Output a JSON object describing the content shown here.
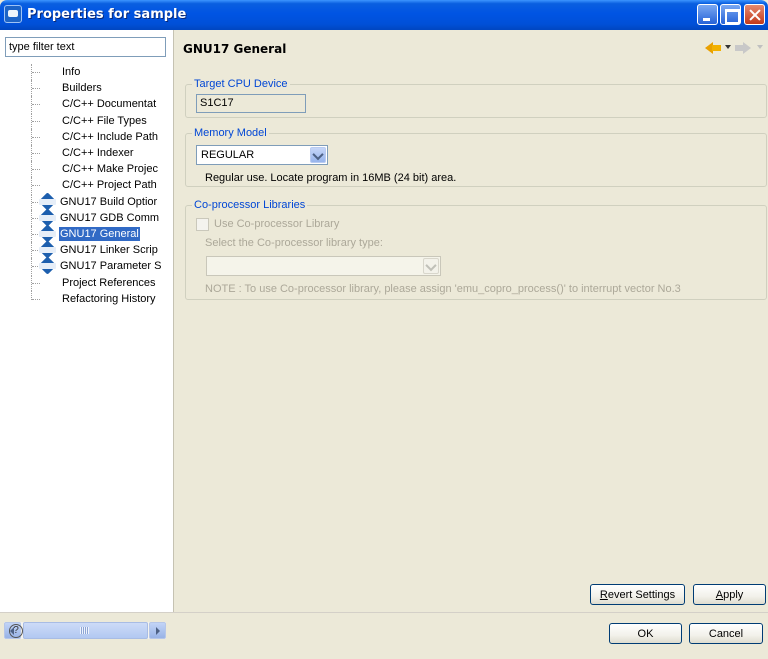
{
  "window": {
    "title": "Properties for sample"
  },
  "filter": {
    "value": "type filter text"
  },
  "tree": {
    "items": [
      {
        "label": "Info",
        "icon": null,
        "selected": false
      },
      {
        "label": "Builders",
        "icon": null,
        "selected": false
      },
      {
        "label": "C/C++ Documentat",
        "icon": null,
        "selected": false
      },
      {
        "label": "C/C++ File Types",
        "icon": null,
        "selected": false
      },
      {
        "label": "C/C++ Include Path",
        "icon": null,
        "selected": false
      },
      {
        "label": "C/C++ Indexer",
        "icon": null,
        "selected": false
      },
      {
        "label": "C/C++ Make Projec",
        "icon": null,
        "selected": false
      },
      {
        "label": "C/C++ Project Path",
        "icon": null,
        "selected": false
      },
      {
        "label": "GNU17 Build Optior",
        "icon": "gnu-icon",
        "selected": false
      },
      {
        "label": "GNU17 GDB Comm",
        "icon": "gnu-icon",
        "selected": false
      },
      {
        "label": "GNU17 General",
        "icon": "gnu-icon",
        "selected": true
      },
      {
        "label": "GNU17 Linker Scrip",
        "icon": "gnu-icon",
        "selected": false
      },
      {
        "label": "GNU17 Parameter S",
        "icon": "gnu-icon",
        "selected": false
      },
      {
        "label": "Project References",
        "icon": null,
        "selected": false
      },
      {
        "label": "Refactoring History",
        "icon": null,
        "selected": false
      }
    ]
  },
  "page": {
    "title": "GNU17 General"
  },
  "target_cpu": {
    "group_title": "Target CPU Device",
    "value": "S1C17"
  },
  "memory_model": {
    "group_title": "Memory Model",
    "selected": "REGULAR",
    "description": "Regular use. Locate program in 16MB (24 bit) area."
  },
  "coprocessor": {
    "group_title": "Co-processor Libraries",
    "checkbox_label": "Use Co-processor Library",
    "checked": false,
    "select_label": "Select the Co-processor library type:",
    "selected": "",
    "note": "NOTE : To use Co-processor library, please assign 'emu_copro_process()' to interrupt vector No.3"
  },
  "buttons": {
    "revert": "Revert Settings",
    "apply": "Apply",
    "ok": "OK",
    "cancel": "Cancel"
  },
  "help": {
    "glyph": "?"
  },
  "colors": {
    "title_bar": "#0054e3",
    "group_title": "#0046d5",
    "selection": "#316ac5",
    "dialog_bg": "#ece9d8"
  }
}
